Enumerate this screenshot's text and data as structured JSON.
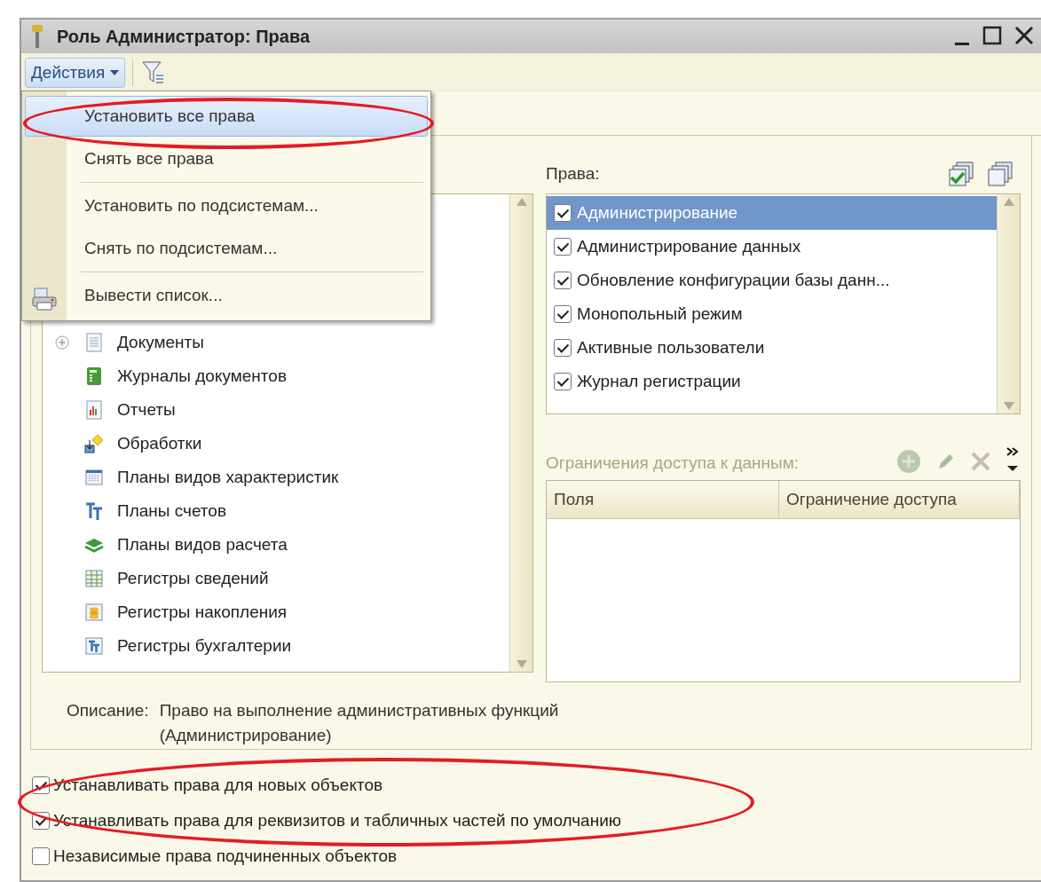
{
  "window": {
    "title": "Роль Администратор: Права"
  },
  "toolbar": {
    "actions_button": "Действия"
  },
  "actions_menu": [
    {
      "label": "Установить все права",
      "selected": true,
      "separator_before": false,
      "kind": "plain"
    },
    {
      "label": "Снять все права",
      "selected": false,
      "separator_before": false,
      "kind": "plain"
    },
    {
      "label": "Установить по подсистемам...",
      "selected": false,
      "separator_before": true,
      "kind": "plain"
    },
    {
      "label": "Снять по подсистемам...",
      "selected": false,
      "separator_before": false,
      "kind": "plain"
    },
    {
      "label": "Вывести список...",
      "selected": false,
      "separator_before": true,
      "kind": "print"
    }
  ],
  "objects_tree": [
    {
      "label": "Документы",
      "expandable": true,
      "kind": "documents"
    },
    {
      "label": "Журналы документов",
      "expandable": false,
      "kind": "journals"
    },
    {
      "label": "Отчеты",
      "expandable": false,
      "kind": "reports"
    },
    {
      "label": "Обработки",
      "expandable": false,
      "kind": "processing"
    },
    {
      "label": "Планы видов характеристик",
      "expandable": false,
      "kind": "charplans"
    },
    {
      "label": "Планы счетов",
      "expandable": false,
      "kind": "accounts"
    },
    {
      "label": "Планы видов расчета",
      "expandable": false,
      "kind": "calcplans"
    },
    {
      "label": "Регистры сведений",
      "expandable": false,
      "kind": "inforeg"
    },
    {
      "label": "Регистры накопления",
      "expandable": false,
      "kind": "accumreg"
    },
    {
      "label": "Регистры бухгалтерии",
      "expandable": false,
      "kind": "accreg"
    }
  ],
  "rights": {
    "label": "Права:",
    "items": [
      {
        "label": "Администрирование",
        "checked": true,
        "selected": true
      },
      {
        "label": "Администрирование данных",
        "checked": true,
        "selected": false
      },
      {
        "label": "Обновление конфигурации базы данн...",
        "checked": true,
        "selected": false
      },
      {
        "label": "Монопольный режим",
        "checked": true,
        "selected": false
      },
      {
        "label": "Активные пользователи",
        "checked": true,
        "selected": false
      },
      {
        "label": "Журнал регистрации",
        "checked": true,
        "selected": false
      }
    ]
  },
  "restrictions": {
    "label": "Ограничения доступа к данным:",
    "columns": [
      "Поля",
      "Ограничение доступа"
    ]
  },
  "description": {
    "label": "Описание:",
    "text": "Право на выполнение административных функций (Администрирование)"
  },
  "options": [
    {
      "label": "Устанавливать права для новых объектов",
      "checked": true
    },
    {
      "label": "Устанавливать права для реквизитов и табличных частей по умолчанию",
      "checked": true
    },
    {
      "label": "Независимые права подчиненных объектов",
      "checked": false
    }
  ]
}
